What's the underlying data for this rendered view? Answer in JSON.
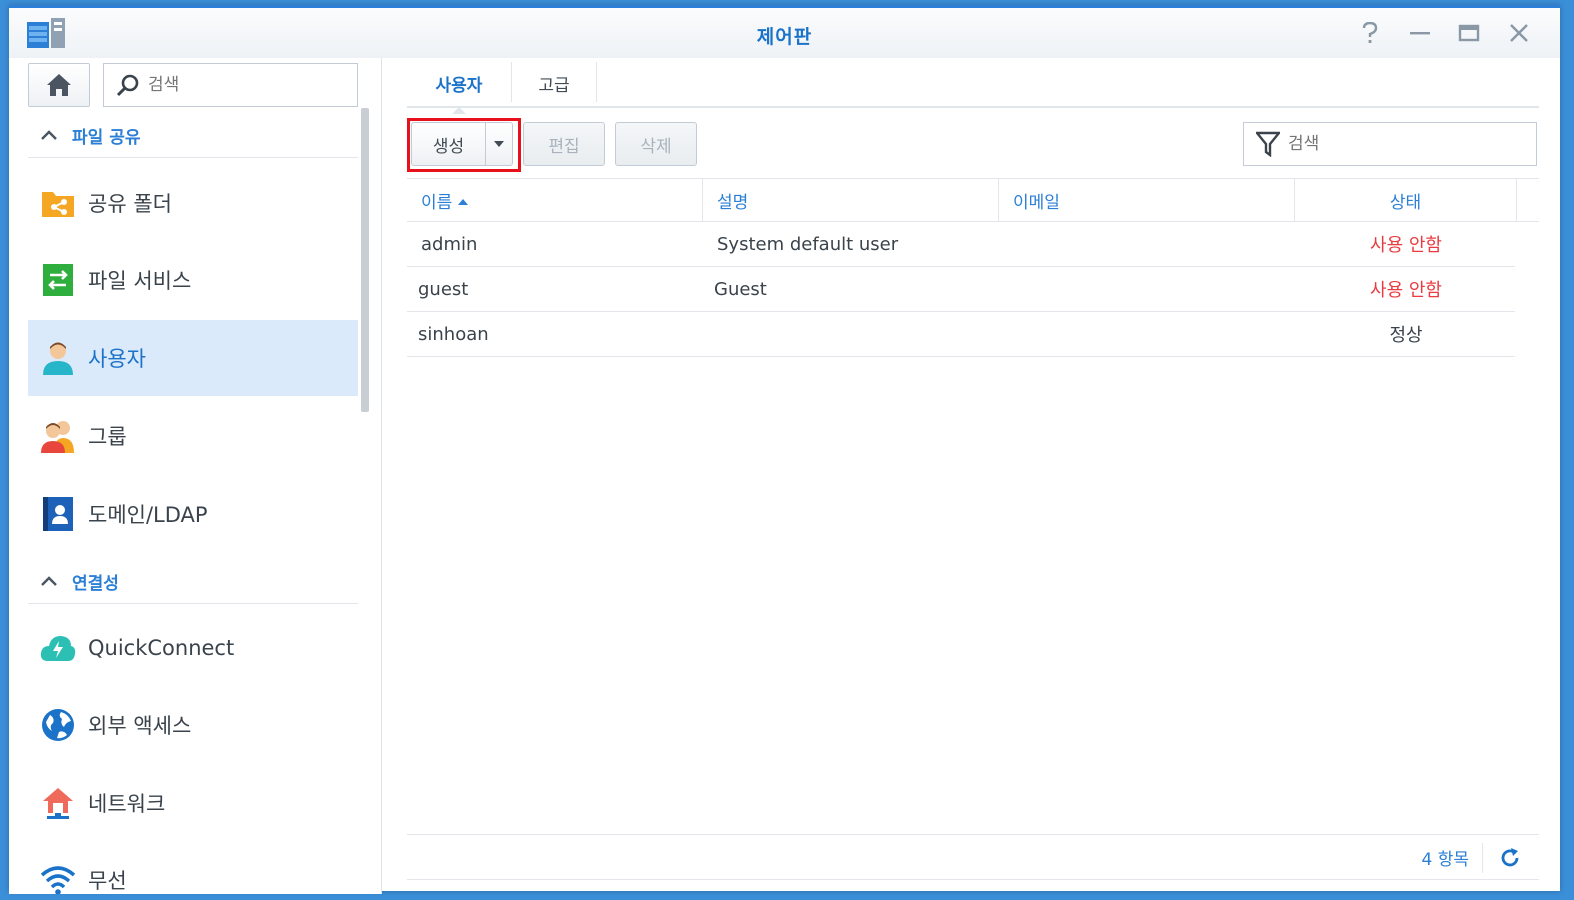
{
  "window": {
    "title": "제어판"
  },
  "sidebar": {
    "search_placeholder": "검색",
    "sections": [
      {
        "label": "파일 공유"
      },
      {
        "label": "연결성"
      }
    ],
    "items": [
      {
        "label": "공유 폴더",
        "icon": "shared-folder-icon"
      },
      {
        "label": "파일 서비스",
        "icon": "file-services-icon"
      },
      {
        "label": "사용자",
        "icon": "user-icon",
        "active": true
      },
      {
        "label": "그룹",
        "icon": "group-icon"
      },
      {
        "label": "도메인/LDAP",
        "icon": "domain-ldap-icon"
      },
      {
        "label": "QuickConnect",
        "icon": "quickconnect-icon"
      },
      {
        "label": "외부 액세스",
        "icon": "external-access-icon"
      },
      {
        "label": "네트워크",
        "icon": "network-icon"
      },
      {
        "label": "무선",
        "icon": "wireless-icon"
      }
    ]
  },
  "tabs": [
    {
      "label": "사용자",
      "active": true
    },
    {
      "label": "고급"
    }
  ],
  "toolbar": {
    "create_label": "생성",
    "edit_label": "편집",
    "delete_label": "삭제",
    "filter_placeholder": "검색"
  },
  "table": {
    "columns": [
      "이름",
      "설명",
      "이메일",
      "상태"
    ],
    "rows": [
      {
        "name": "admin",
        "description": "System default user",
        "email": "",
        "status": "사용 안함"
      },
      {
        "name": "guest",
        "description": "Guest",
        "email": "",
        "status": "사용 안함"
      },
      {
        "name": "sinhoan",
        "description": "",
        "email": "",
        "status": "정상"
      }
    ]
  },
  "footer": {
    "count": "4 항목"
  },
  "colors": {
    "accent": "#2b7fd6",
    "highlight": "#e8101a",
    "status_disabled": "#ea3c40",
    "active_bg": "#dbeafa"
  }
}
